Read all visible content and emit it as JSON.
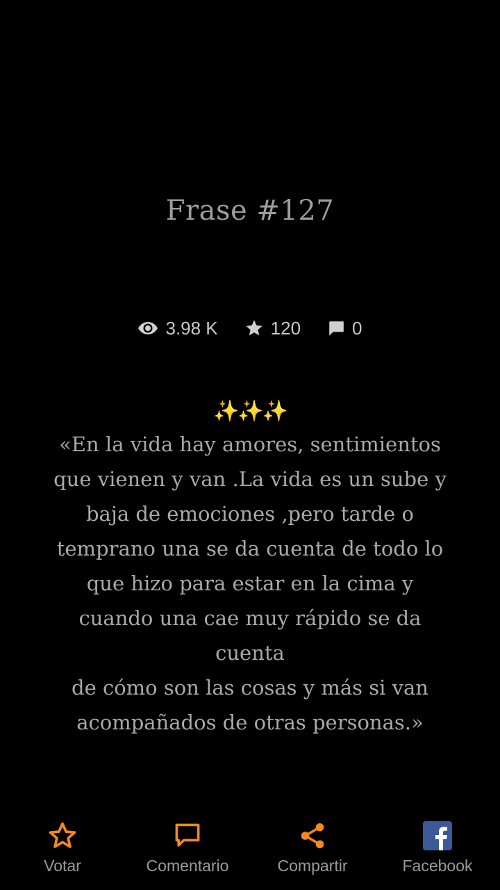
{
  "title": "Frase #127",
  "stats": {
    "views": "3.98 K",
    "stars": "120",
    "comments": "0"
  },
  "quote": {
    "emoji": "✨✨✨",
    "text": "«En la vida hay amores, sentimientos que vienen y van .La vida es un sube y baja de emociones ,pero tarde o temprano una se da cuenta de todo lo que hizo para estar en la cima y\ncuando una cae muy rápido se da cuenta\nde cómo son las cosas y más si van acompañados de otras personas.»"
  },
  "actions": {
    "vote_label": "Votar",
    "comment_label": "Comentario",
    "share_label": "Compartir",
    "facebook_label": "Facebook"
  },
  "colors": {
    "background": "#000000",
    "accent": "#f5881f",
    "text": "#a9a9a9",
    "facebook": "#3b5998"
  },
  "icons": {
    "views": "eye-icon",
    "stars": "star-icon",
    "comments": "speech-bubble-icon",
    "vote": "star-outline-icon",
    "comment": "comment-icon",
    "share": "share-icon",
    "facebook": "facebook-icon"
  }
}
